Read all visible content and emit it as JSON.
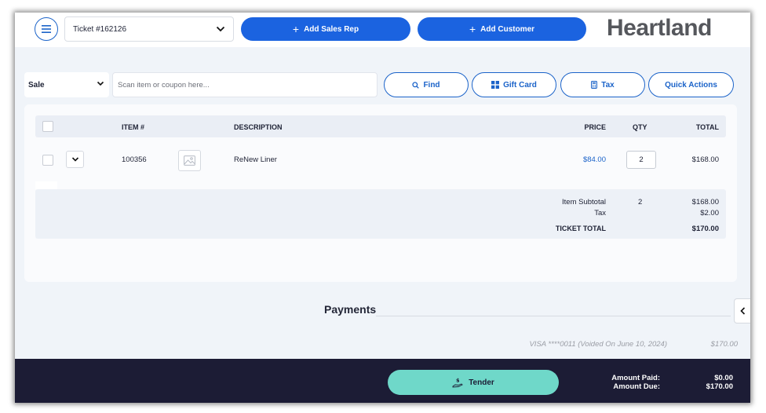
{
  "header": {
    "ticket_label": "Ticket #162126",
    "add_sales_rep": "Add Sales Rep",
    "add_customer": "Add Customer",
    "brand": "Heartland"
  },
  "scan_bar": {
    "mode": "Sale",
    "placeholder": "Scan item or coupon here...",
    "find": "Find",
    "gift_card": "Gift Card",
    "tax": "Tax",
    "quick_actions": "Quick Actions"
  },
  "table": {
    "columns": {
      "item": "ITEM #",
      "description": "DESCRIPTION",
      "price": "PRICE",
      "qty": "QTY",
      "total": "TOTAL"
    },
    "rows": [
      {
        "item": "100356",
        "description": "ReNew Liner",
        "price": "$84.00",
        "qty": "2",
        "total": "$168.00"
      }
    ]
  },
  "totals": {
    "subtotal_label": "Item Subtotal",
    "subtotal_qty": "2",
    "subtotal_value": "$168.00",
    "tax_label": "Tax",
    "tax_value": "$2.00",
    "ticket_total_label": "TICKET TOTAL",
    "ticket_total_value": "$170.00"
  },
  "payments": {
    "title": "Payments",
    "entries": [
      {
        "desc": "VISA ****0011 (Voided On June 10, 2024)",
        "amount": "$170.00"
      }
    ]
  },
  "footer": {
    "tender": "Tender",
    "amount_paid_label": "Amount Paid:",
    "amount_paid_value": "$0.00",
    "amount_due_label": "Amount Due:",
    "amount_due_value": "$170.00"
  },
  "colors": {
    "primary": "#1b63e0",
    "tender": "#6fd8c9",
    "footer_bg": "#1c1c35",
    "link_price": "#1b63c9"
  },
  "icons": {
    "menu": "hamburger-icon",
    "dropdown": "chevron-down-icon",
    "add": "plus-icon",
    "find": "search-icon",
    "gift_card": "grid-icon",
    "tax": "calculator-icon",
    "image": "image-placeholder-icon",
    "collapse": "chevron-left-icon",
    "tender": "cash-hand-icon"
  }
}
